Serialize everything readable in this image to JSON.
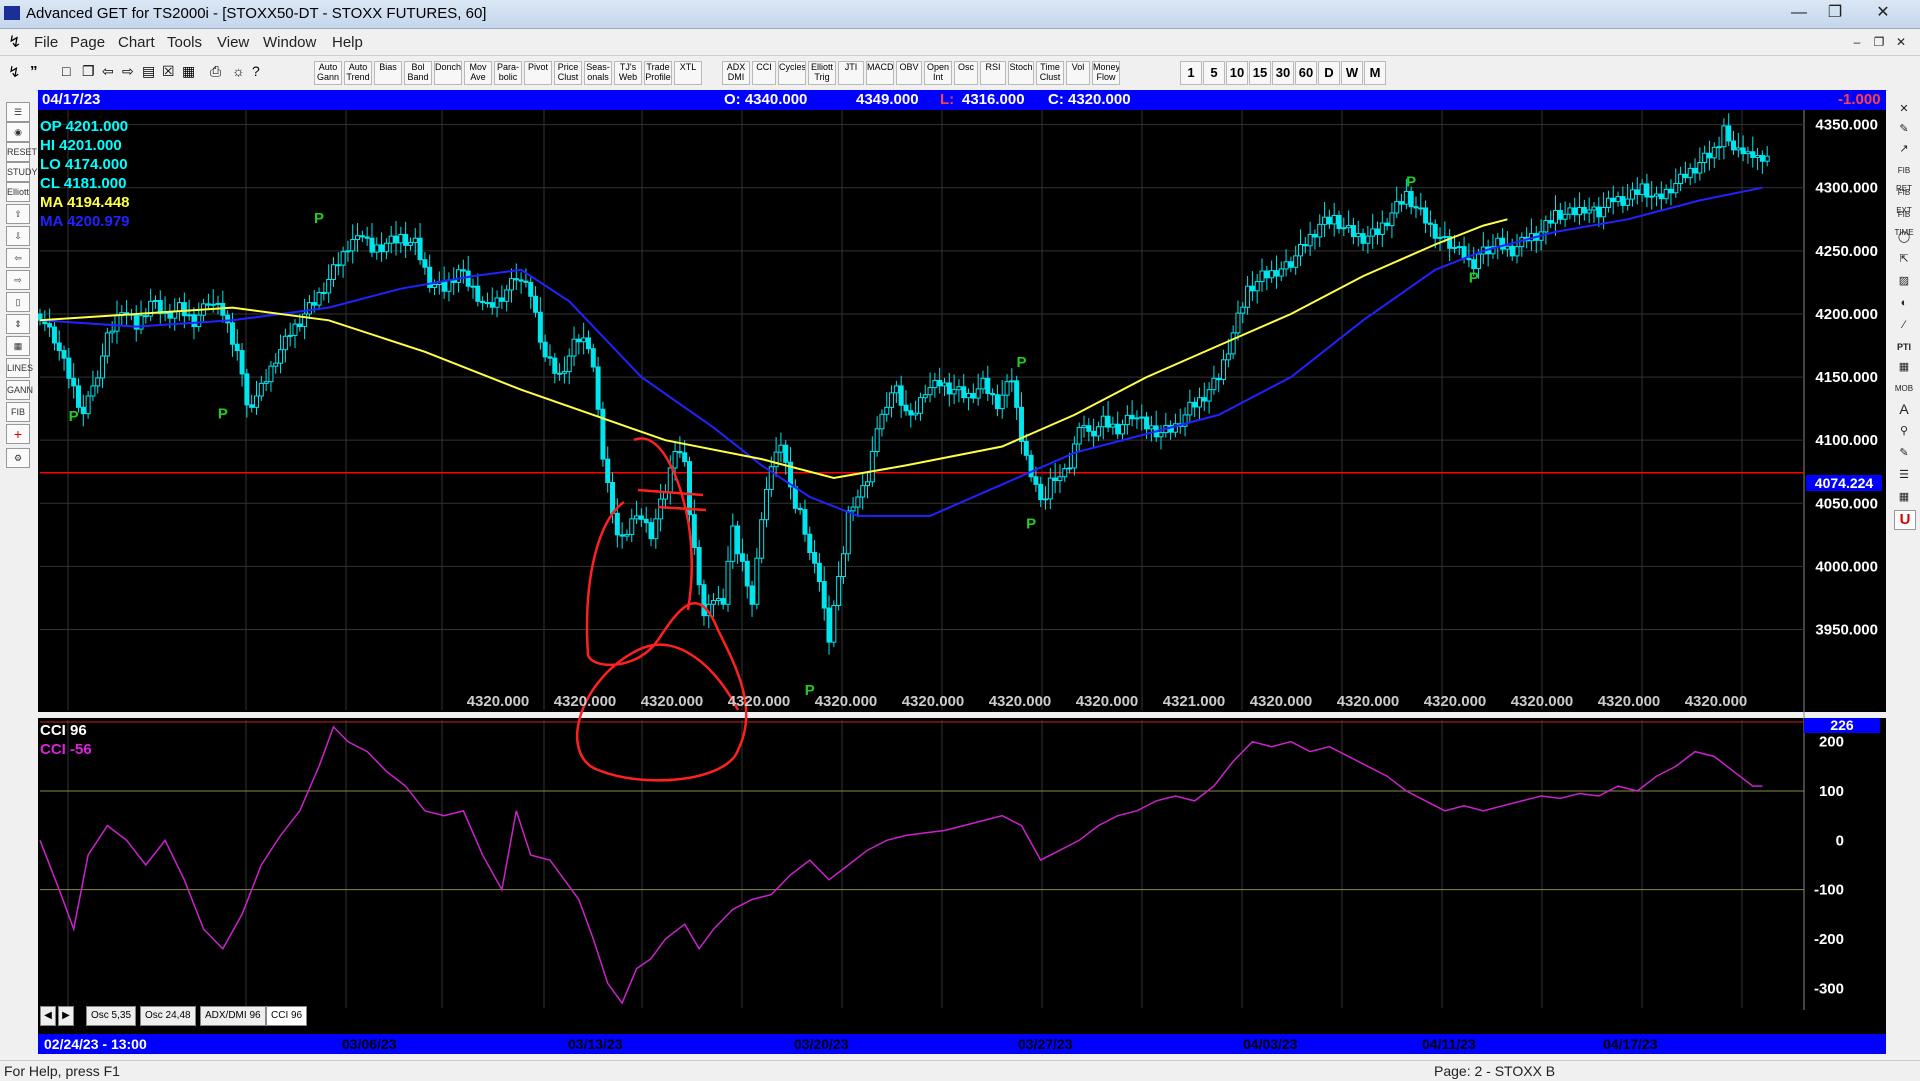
{
  "window": {
    "title": "Advanced GET for TS2000i - [STOXX50-DT - STOXX FUTURES, 60]",
    "app_icon": "chart-app-icon"
  },
  "menu": [
    "File",
    "Page",
    "Chart",
    "Tools",
    "View",
    "Window",
    "Help"
  ],
  "toolbar": {
    "buttons": [
      "Auto Gann",
      "Auto Trend",
      "Bias",
      "Bol Band",
      "Donch",
      "Mov Ave",
      "Para-bolic",
      "Pivot",
      "Price Clust",
      "Seas-onals",
      "TJ's Web",
      "Trade Profile",
      "XTL",
      "ADX DMI",
      "CCI",
      "Cycles",
      "Elliott Trig",
      "JTI",
      "MACD",
      "OBV",
      "Open Int",
      "Osc",
      "RSI",
      "Stoch",
      "Time Clust",
      "Vol",
      "Money Flow"
    ],
    "timeframes": [
      "1",
      "5",
      "10",
      "15",
      "30",
      "60",
      "D",
      "W",
      "M"
    ]
  },
  "infobar": {
    "date": "04/17/23",
    "open": "O: 4340.000",
    "high": "4349.000",
    "low_label": "L:",
    "low": "4316.000",
    "close": "C: 4320.000",
    "change": "-1.000"
  },
  "legend": {
    "op": "OP  4201.000",
    "hi": "HI   4201.000",
    "lo": "LO  4174.000",
    "cl": "CL  4181.000",
    "ma1": "MA  4194.448",
    "ma2": "MA  4200.979"
  },
  "cci_legend": {
    "line1": "CCI 96",
    "line2": "CCI  -56",
    "value_box": "226"
  },
  "cursor_price": "4074.224",
  "price_row": [
    "4320.000",
    "4320.000",
    "4320.000",
    "4320.000",
    "4320.000",
    "4320.000",
    "4320.000",
    "4320.000",
    "4321.000",
    "4320.000",
    "4320.000",
    "4320.000",
    "4320.000",
    "4320.000",
    "4320.000"
  ],
  "osc_tabs": [
    "Osc 5,35",
    "Osc 24,48",
    "ADX/DMI 96",
    "CCI 96"
  ],
  "date_labels": [
    "02/24/23 - 13:00",
    "03/06/23",
    "03/13/23",
    "03/20/23",
    "03/27/23",
    "04/03/23",
    "04/11/23",
    "04/17/23"
  ],
  "status": {
    "help": "For Help, press F1",
    "page": "Page: 2 - STOXX B"
  },
  "colors": {
    "background": "#000000",
    "candle": "#00e5ee",
    "ma_fast": "#ffff44",
    "ma_slow": "#2222ff",
    "cci": "#cc22cc",
    "pivot": "#22cc22",
    "annotation": "#ff2020",
    "hline": "#ff0000"
  },
  "chart_data": [
    {
      "type": "candlestick",
      "title": "STOXX50-DT - STOXX FUTURES, 60",
      "ylim": [
        3910,
        4360
      ],
      "yticks": [
        3950,
        4000,
        4050,
        4100,
        4150,
        4200,
        4250,
        4300,
        4350
      ],
      "ytick_labels": [
        "3950.000",
        "4000.000",
        "4050.000",
        "4100.000",
        "4150.000",
        "4200.000",
        "4250.000",
        "4300.000",
        "4350.000"
      ],
      "path_closes": [
        [
          0,
          4200
        ],
        [
          3,
          4180
        ],
        [
          6,
          4150
        ],
        [
          9,
          4120
        ],
        [
          11,
          4140
        ],
        [
          14,
          4180
        ],
        [
          17,
          4205
        ],
        [
          20,
          4190
        ],
        [
          23,
          4210
        ],
        [
          26,
          4200
        ],
        [
          29,
          4205
        ],
        [
          32,
          4195
        ],
        [
          35,
          4210
        ],
        [
          38,
          4200
        ],
        [
          41,
          4170
        ],
        [
          43,
          4125
        ],
        [
          46,
          4140
        ],
        [
          49,
          4165
        ],
        [
          52,
          4185
        ],
        [
          55,
          4200
        ],
        [
          58,
          4215
        ],
        [
          61,
          4235
        ],
        [
          64,
          4255
        ],
        [
          66,
          4265
        ],
        [
          69,
          4250
        ],
        [
          72,
          4255
        ],
        [
          75,
          4260
        ],
        [
          78,
          4255
        ],
        [
          81,
          4225
        ],
        [
          84,
          4220
        ],
        [
          87,
          4235
        ],
        [
          90,
          4220
        ],
        [
          93,
          4205
        ],
        [
          96,
          4215
        ],
        [
          99,
          4230
        ],
        [
          102,
          4215
        ],
        [
          105,
          4165
        ],
        [
          108,
          4150
        ],
        [
          111,
          4175
        ],
        [
          113,
          4185
        ],
        [
          115,
          4160
        ],
        [
          117,
          4085
        ],
        [
          119,
          4040
        ],
        [
          121,
          4020
        ],
        [
          124,
          4045
        ],
        [
          127,
          4025
        ],
        [
          130,
          4060
        ],
        [
          132,
          4090
        ],
        [
          134,
          4080
        ],
        [
          136,
          4010
        ],
        [
          138,
          3965
        ],
        [
          140,
          3975
        ],
        [
          142,
          3970
        ],
        [
          144,
          4030
        ],
        [
          146,
          4000
        ],
        [
          148,
          3975
        ],
        [
          150,
          4040
        ],
        [
          152,
          4080
        ],
        [
          154,
          4095
        ],
        [
          156,
          4060
        ],
        [
          158,
          4040
        ],
        [
          160,
          4015
        ],
        [
          162,
          3990
        ],
        [
          164,
          3940
        ],
        [
          166,
          3990
        ],
        [
          168,
          4040
        ],
        [
          170,
          4060
        ],
        [
          172,
          4070
        ],
        [
          174,
          4110
        ],
        [
          176,
          4125
        ],
        [
          178,
          4140
        ],
        [
          181,
          4115
        ],
        [
          184,
          4140
        ],
        [
          187,
          4145
        ],
        [
          190,
          4140
        ],
        [
          193,
          4135
        ],
        [
          196,
          4145
        ],
        [
          199,
          4130
        ],
        [
          202,
          4150
        ],
        [
          204,
          4100
        ],
        [
          206,
          4070
        ],
        [
          208,
          4050
        ],
        [
          210,
          4065
        ],
        [
          212,
          4075
        ],
        [
          214,
          4080
        ],
        [
          216,
          4110
        ],
        [
          218,
          4105
        ],
        [
          221,
          4115
        ],
        [
          224,
          4110
        ],
        [
          227,
          4120
        ],
        [
          230,
          4110
        ],
        [
          233,
          4105
        ],
        [
          236,
          4110
        ],
        [
          239,
          4125
        ],
        [
          242,
          4135
        ],
        [
          245,
          4150
        ],
        [
          248,
          4185
        ],
        [
          251,
          4220
        ],
        [
          254,
          4230
        ],
        [
          257,
          4235
        ],
        [
          260,
          4240
        ],
        [
          263,
          4255
        ],
        [
          266,
          4270
        ],
        [
          269,
          4275
        ],
        [
          272,
          4265
        ],
        [
          275,
          4260
        ],
        [
          278,
          4265
        ],
        [
          281,
          4280
        ],
        [
          284,
          4295
        ],
        [
          287,
          4280
        ],
        [
          290,
          4265
        ],
        [
          293,
          4255
        ],
        [
          296,
          4245
        ],
        [
          298,
          4235
        ],
        [
          300,
          4250
        ],
        [
          303,
          4255
        ],
        [
          306,
          4250
        ],
        [
          309,
          4260
        ],
        [
          312,
          4265
        ],
        [
          315,
          4280
        ],
        [
          318,
          4280
        ],
        [
          321,
          4285
        ],
        [
          324,
          4280
        ],
        [
          327,
          4290
        ],
        [
          330,
          4290
        ],
        [
          333,
          4300
        ],
        [
          336,
          4290
        ],
        [
          339,
          4300
        ],
        [
          342,
          4310
        ],
        [
          345,
          4320
        ],
        [
          348,
          4330
        ],
        [
          350,
          4345
        ],
        [
          352,
          4335
        ],
        [
          354,
          4330
        ],
        [
          356,
          4325
        ],
        [
          358,
          4320
        ]
      ],
      "ma_fast": [
        [
          0,
          4195
        ],
        [
          20,
          4200
        ],
        [
          40,
          4205
        ],
        [
          60,
          4195
        ],
        [
          80,
          4170
        ],
        [
          100,
          4140
        ],
        [
          115,
          4120
        ],
        [
          130,
          4100
        ],
        [
          150,
          4085
        ],
        [
          165,
          4070
        ],
        [
          180,
          4080
        ],
        [
          200,
          4095
        ],
        [
          215,
          4120
        ],
        [
          230,
          4150
        ],
        [
          245,
          4175
        ],
        [
          260,
          4200
        ],
        [
          275,
          4230
        ],
        [
          290,
          4255
        ],
        [
          300,
          4270
        ],
        [
          305,
          4275
        ]
      ],
      "ma_slow": [
        [
          0,
          4195
        ],
        [
          20,
          4190
        ],
        [
          40,
          4195
        ],
        [
          60,
          4205
        ],
        [
          75,
          4220
        ],
        [
          90,
          4230
        ],
        [
          100,
          4235
        ],
        [
          110,
          4210
        ],
        [
          125,
          4150
        ],
        [
          140,
          4110
        ],
        [
          150,
          4080
        ],
        [
          160,
          4055
        ],
        [
          170,
          4040
        ],
        [
          185,
          4040
        ],
        [
          200,
          4065
        ],
        [
          215,
          4090
        ],
        [
          230,
          4105
        ],
        [
          245,
          4120
        ],
        [
          260,
          4150
        ],
        [
          275,
          4195
        ],
        [
          290,
          4235
        ],
        [
          300,
          4250
        ],
        [
          315,
          4265
        ],
        [
          330,
          4275
        ],
        [
          345,
          4290
        ],
        [
          358,
          4300
        ]
      ],
      "pivots": [
        [
          7,
          4115,
          "P"
        ],
        [
          38,
          4117,
          "P"
        ],
        [
          58,
          4272,
          "P"
        ],
        [
          160,
          3898,
          "P"
        ],
        [
          206,
          4030,
          "P"
        ],
        [
          204,
          4158,
          "P"
        ],
        [
          285,
          4301,
          "P"
        ],
        [
          298,
          4225,
          "P"
        ]
      ],
      "hline": 4074.224
    },
    {
      "type": "line",
      "title": "CCI 96",
      "series": [
        {
          "name": "CCI",
          "values_xy": [
            [
              0,
              0
            ],
            [
              4,
              -100
            ],
            [
              7,
              -180
            ],
            [
              10,
              -30
            ],
            [
              14,
              30
            ],
            [
              18,
              0
            ],
            [
              22,
              -50
            ],
            [
              26,
              0
            ],
            [
              30,
              -80
            ],
            [
              34,
              -180
            ],
            [
              38,
              -220
            ],
            [
              42,
              -150
            ],
            [
              46,
              -50
            ],
            [
              50,
              10
            ],
            [
              54,
              60
            ],
            [
              58,
              150
            ],
            [
              61,
              230
            ],
            [
              64,
              200
            ],
            [
              68,
              180
            ],
            [
              72,
              140
            ],
            [
              76,
              110
            ],
            [
              80,
              60
            ],
            [
              84,
              50
            ],
            [
              88,
              60
            ],
            [
              92,
              -30
            ],
            [
              96,
              -100
            ],
            [
              99,
              60
            ],
            [
              102,
              -30
            ],
            [
              106,
              -40
            ],
            [
              109,
              -80
            ],
            [
              112,
              -120
            ],
            [
              115,
              -200
            ],
            [
              118,
              -290
            ],
            [
              121,
              -330
            ],
            [
              124,
              -260
            ],
            [
              127,
              -240
            ],
            [
              130,
              -200
            ],
            [
              134,
              -170
            ],
            [
              137,
              -220
            ],
            [
              140,
              -180
            ],
            [
              144,
              -140
            ],
            [
              148,
              -120
            ],
            [
              152,
              -110
            ],
            [
              156,
              -70
            ],
            [
              160,
              -40
            ],
            [
              164,
              -80
            ],
            [
              168,
              -50
            ],
            [
              172,
              -20
            ],
            [
              176,
              0
            ],
            [
              180,
              10
            ],
            [
              184,
              15
            ],
            [
              188,
              20
            ],
            [
              192,
              30
            ],
            [
              196,
              40
            ],
            [
              200,
              50
            ],
            [
              204,
              30
            ],
            [
              208,
              -40
            ],
            [
              212,
              -20
            ],
            [
              216,
              0
            ],
            [
              220,
              30
            ],
            [
              224,
              50
            ],
            [
              228,
              60
            ],
            [
              232,
              80
            ],
            [
              236,
              90
            ],
            [
              240,
              80
            ],
            [
              244,
              110
            ],
            [
              248,
              160
            ],
            [
              252,
              200
            ],
            [
              256,
              190
            ],
            [
              260,
              200
            ],
            [
              264,
              180
            ],
            [
              268,
              190
            ],
            [
              272,
              170
            ],
            [
              276,
              150
            ],
            [
              280,
              130
            ],
            [
              284,
              100
            ],
            [
              288,
              80
            ],
            [
              292,
              60
            ],
            [
              296,
              70
            ],
            [
              300,
              60
            ],
            [
              304,
              70
            ],
            [
              308,
              80
            ],
            [
              312,
              90
            ],
            [
              316,
              85
            ],
            [
              320,
              95
            ],
            [
              324,
              90
            ],
            [
              328,
              110
            ],
            [
              332,
              100
            ],
            [
              336,
              130
            ],
            [
              340,
              150
            ],
            [
              344,
              180
            ],
            [
              348,
              170
            ],
            [
              352,
              140
            ],
            [
              356,
              110
            ],
            [
              358,
              110
            ]
          ]
        }
      ],
      "ylim": [
        -340,
        240
      ],
      "yticks": [
        -300,
        -200,
        -100,
        0,
        100,
        200
      ],
      "ytick_labels": [
        "-300",
        "-200",
        "-100",
        "0",
        "100",
        "200"
      ],
      "levels": [
        100,
        -100
      ]
    }
  ]
}
